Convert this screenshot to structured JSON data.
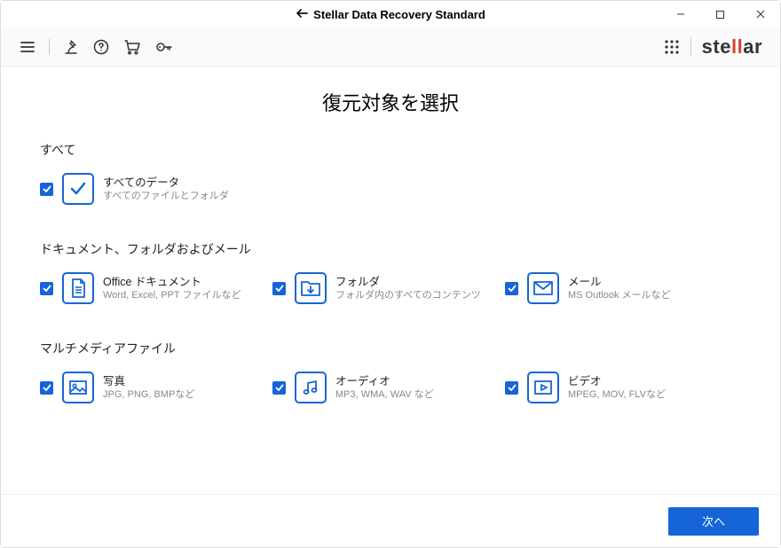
{
  "window": {
    "title": "Stellar Data Recovery Standard"
  },
  "logo": {
    "pre": "ste",
    "mid": "ll",
    "post": "ar"
  },
  "page": {
    "title": "復元対象を選択"
  },
  "sections": {
    "all": {
      "header": "すべて",
      "item": {
        "label": "すべてのデータ",
        "desc": "すべてのファイルとフォルダ"
      }
    },
    "docs": {
      "header": "ドキュメント、フォルダおよびメール",
      "office": {
        "label": "Office ドキュメント",
        "desc": "Word, Excel, PPT ファイルなど"
      },
      "folder": {
        "label": "フォルダ",
        "desc": "フォルダ内のすべてのコンテンツ"
      },
      "mail": {
        "label": "メール",
        "desc": "MS Outlook メールなど"
      }
    },
    "media": {
      "header": "マルチメディアファイル",
      "photo": {
        "label": "写真",
        "desc": "JPG, PNG, BMPなど"
      },
      "audio": {
        "label": "オーディオ",
        "desc": "MP3, WMA, WAV など"
      },
      "video": {
        "label": "ビデオ",
        "desc": "MPEG, MOV, FLVなど"
      }
    }
  },
  "footer": {
    "next": "次へ"
  }
}
